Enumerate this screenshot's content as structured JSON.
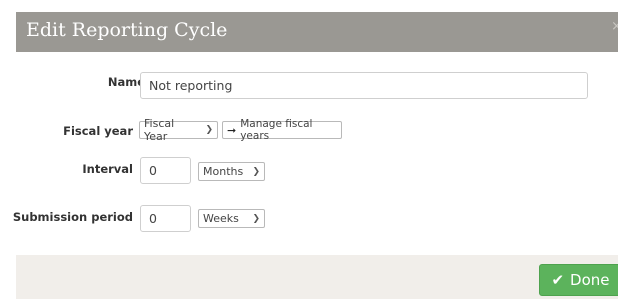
{
  "dialog": {
    "title": "Edit Reporting Cycle",
    "close_glyph": "×"
  },
  "form": {
    "name": {
      "label": "Name",
      "value": "Not reporting"
    },
    "fiscal_year": {
      "label": "Fiscal year",
      "selected": "Fiscal Year",
      "manage_label": "Manage fiscal years",
      "manage_icon": "arrow-right-icon"
    },
    "interval": {
      "label": "Interval",
      "value": "0",
      "unit": "Months"
    },
    "submission_period": {
      "label": "Submission period",
      "value": "0",
      "unit": "Weeks"
    }
  },
  "footer": {
    "done_label": "Done",
    "done_icon": "check-icon",
    "done_color": "#5cb35c"
  },
  "colors": {
    "header_bg": "#9a9893",
    "footer_bg": "#f1eeea"
  }
}
